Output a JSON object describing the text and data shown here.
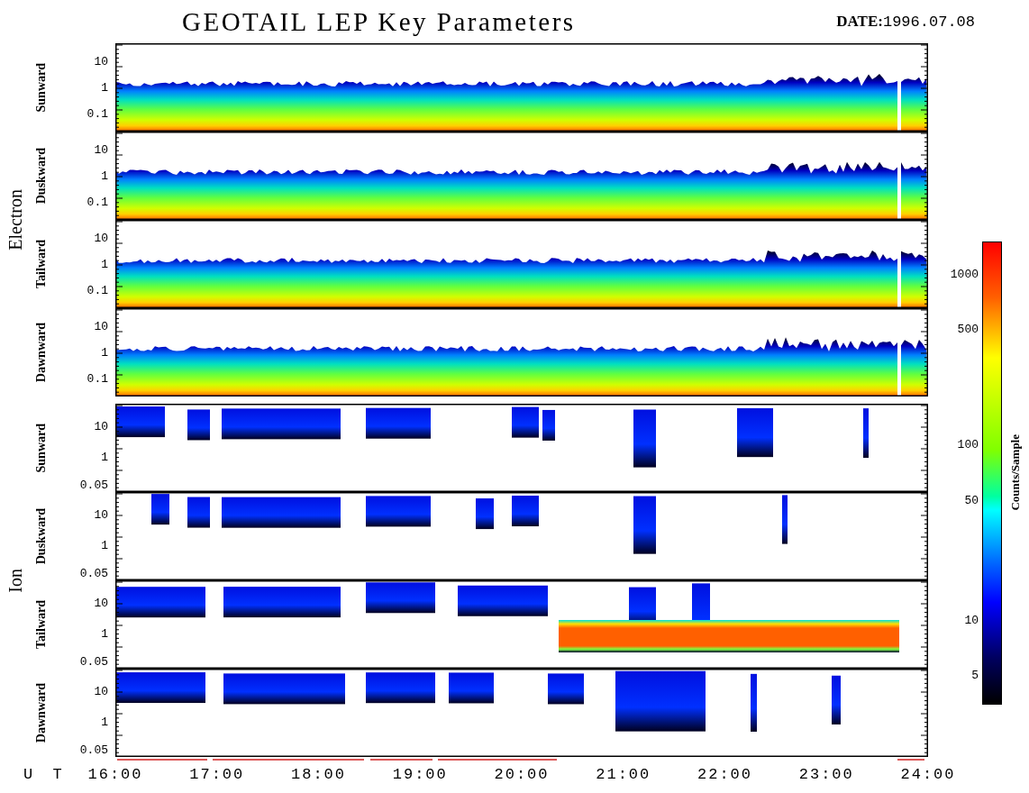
{
  "title": "GEOTAIL LEP Key Parameters",
  "date": {
    "label": "DATE:",
    "value": "1996.07.08"
  },
  "groups": [
    {
      "label": "Electron",
      "kind": "electron",
      "panels": [
        {
          "direction": "Sunward",
          "y_ticks": [
            "10",
            "1",
            "0.1"
          ]
        },
        {
          "direction": "Duskward",
          "y_ticks": [
            "10",
            "1",
            "0.1"
          ]
        },
        {
          "direction": "Tailward",
          "y_ticks": [
            "10",
            "1",
            "0.1"
          ]
        },
        {
          "direction": "Dawnward",
          "y_ticks": [
            "10",
            "1",
            "0.1"
          ]
        }
      ]
    },
    {
      "label": "Ion",
      "kind": "ion",
      "panels": [
        {
          "direction": "Sunward",
          "y_ticks": [
            "10",
            "1",
            "0.05"
          ]
        },
        {
          "direction": "Duskward",
          "y_ticks": [
            "10",
            "1",
            "0.05"
          ]
        },
        {
          "direction": "Tailward",
          "y_ticks": [
            "10",
            "1",
            "0.05"
          ]
        },
        {
          "direction": "Dawnward",
          "y_ticks": [
            "10",
            "1",
            "0.05"
          ]
        }
      ]
    }
  ],
  "colorbar": {
    "label": "Counts/Sample",
    "ticks": [
      "1000",
      "500",
      "100",
      "50",
      "10",
      "5"
    ]
  },
  "x_axis": {
    "label": "U T",
    "ticks": [
      "16:00",
      "17:00",
      "18:00",
      "19:00",
      "20:00",
      "21:00",
      "22:00",
      "23:00",
      "24:00"
    ]
  }
}
